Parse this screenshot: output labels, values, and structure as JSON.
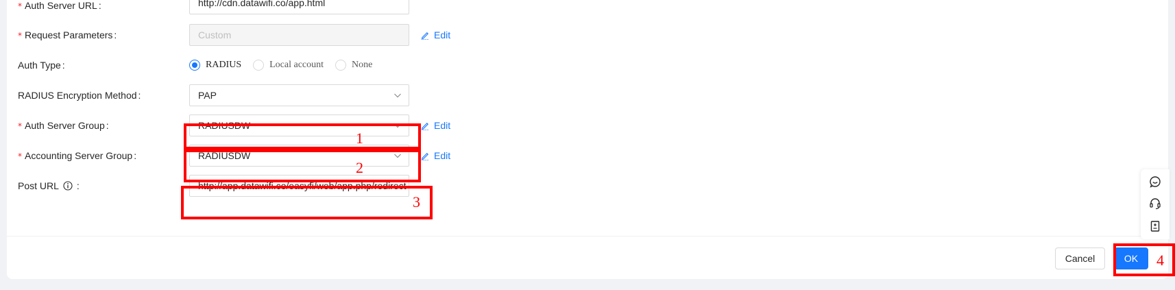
{
  "form": {
    "auth_server_url": {
      "label": "Auth Server URL",
      "required": "*",
      "value": "http://cdn.datawifi.co/app.html"
    },
    "request_parameters": {
      "label": "Request Parameters",
      "required": "*",
      "value": "Custom",
      "edit_label": "Edit"
    },
    "auth_type": {
      "label": "Auth Type",
      "options": [
        "RADIUS",
        "Local account",
        "None"
      ],
      "selected": "RADIUS"
    },
    "radius_encryption": {
      "label": "RADIUS Encryption Method",
      "value": "PAP"
    },
    "auth_server_group": {
      "label": "Auth Server Group",
      "required": "*",
      "value": "RADIUSDW",
      "edit_label": "Edit"
    },
    "accounting_server_group": {
      "label": "Accounting Server Group",
      "required": "*",
      "value": "RADIUSDW",
      "edit_label": "Edit"
    },
    "post_url": {
      "label": "Post URL",
      "value": "http://app.datawifi.co/easyfi/web/app.php/redirect"
    },
    "colon": ":"
  },
  "footer": {
    "cancel_label": "Cancel",
    "ok_label": "OK"
  },
  "annotations": {
    "n1": "1",
    "n2": "2",
    "n3": "3",
    "n4": "4",
    "color": "#ff0000"
  },
  "floating_tools": {
    "icons": [
      "chat-icon",
      "headset-icon",
      "document-icon"
    ]
  },
  "colors": {
    "primary": "#1677ff",
    "required": "#f5222d",
    "annotation": "#ff0000"
  }
}
